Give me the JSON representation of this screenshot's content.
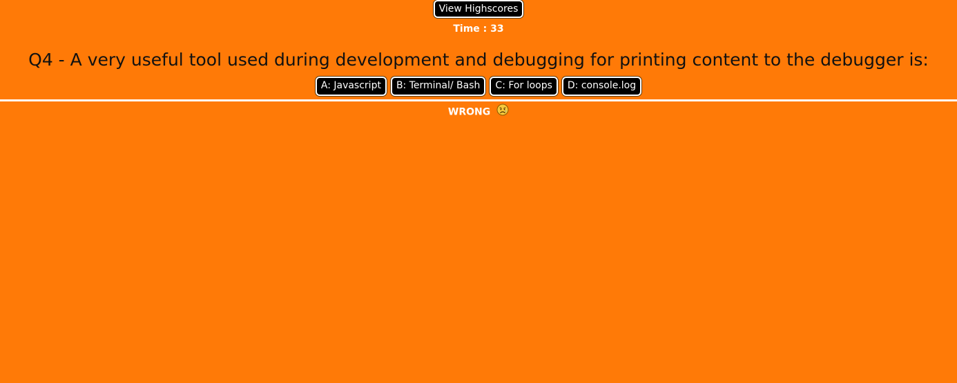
{
  "header": {
    "highscores_label": "View Highscores",
    "timer_text": "Time : 33"
  },
  "question": {
    "text": "Q4 - A very useful tool used during development and debugging for printing content to the debugger is:"
  },
  "answers": [
    {
      "label": "A: Javascript"
    },
    {
      "label": "B: Terminal/ Bash"
    },
    {
      "label": "C: For loops"
    },
    {
      "label": "D: console.log"
    }
  ],
  "feedback": {
    "text": "WRONG",
    "icon": "sad-face-icon"
  },
  "colors": {
    "background": "#ff7a07",
    "button_bg": "#000000",
    "button_text": "#ffffff",
    "divider": "#ffffff"
  }
}
